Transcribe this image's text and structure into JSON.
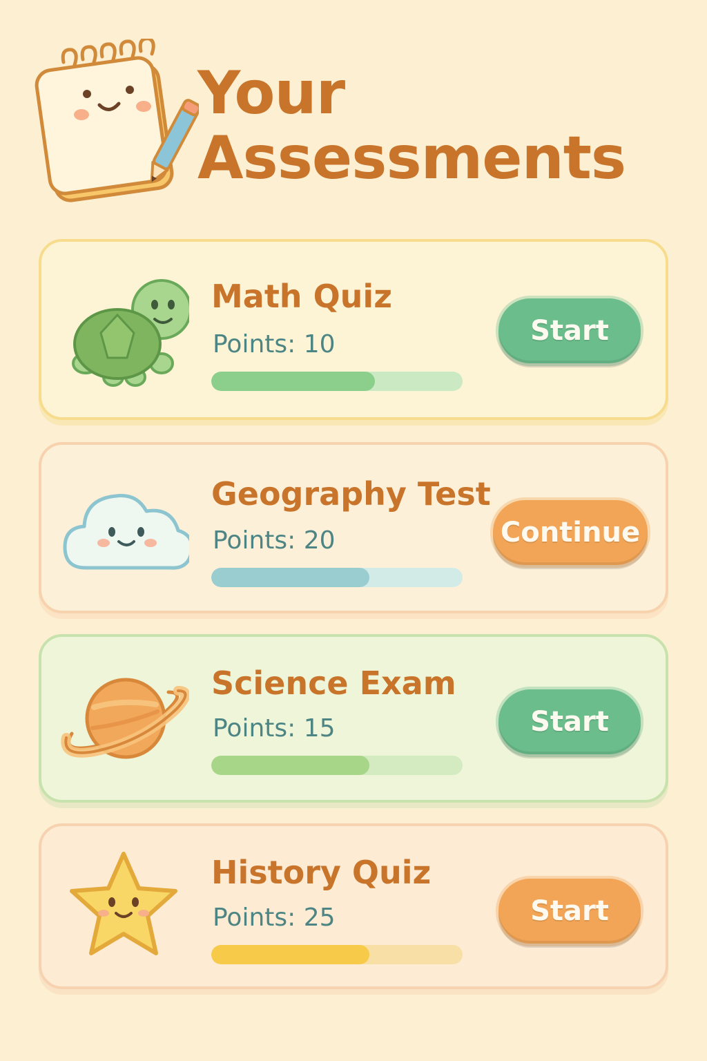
{
  "header": {
    "title": "Your Assessments",
    "icon": "notepad-pencil-icon"
  },
  "colors": {
    "background": "#fdefd2",
    "title": "#c8752b",
    "points_text": "#4d8584",
    "green_button": "#6bbd8c",
    "orange_button": "#f2a556"
  },
  "assessments": [
    {
      "title": "Math Quiz",
      "points": "Points: 10",
      "button_label": "Start",
      "button_color": "#6bbd8c",
      "progress": 0.65,
      "progress_color": "#8ccf8c",
      "track_color": "#cbe9c2",
      "card_bg": "#fdf4d6",
      "card_border": "#f6dc8c",
      "icon": "turtle-icon"
    },
    {
      "title": "Geography Test",
      "points": "Points: 20",
      "button_label": "Continue",
      "button_color": "#f2a556",
      "progress": 0.63,
      "progress_color": "#9acdd0",
      "track_color": "#d2ebe6",
      "card_bg": "#fdf0d8",
      "card_border": "#f7d2ae",
      "icon": "cloud-icon"
    },
    {
      "title": "Science Exam",
      "points": "Points: 15",
      "button_label": "Start",
      "button_color": "#6bbd8c",
      "progress": 0.63,
      "progress_color": "#a8d689",
      "track_color": "#d4ebc2",
      "card_bg": "#eef5d8",
      "card_border": "#c8e2ae",
      "icon": "planet-icon"
    },
    {
      "title": "History Quiz",
      "points": "Points: 25",
      "button_label": "Start",
      "button_color": "#f2a556",
      "progress": 0.63,
      "progress_color": "#f8ca4a",
      "track_color": "#f8dfa6",
      "card_bg": "#fdebd4",
      "card_border": "#f6d2b0",
      "icon": "star-icon"
    }
  ]
}
